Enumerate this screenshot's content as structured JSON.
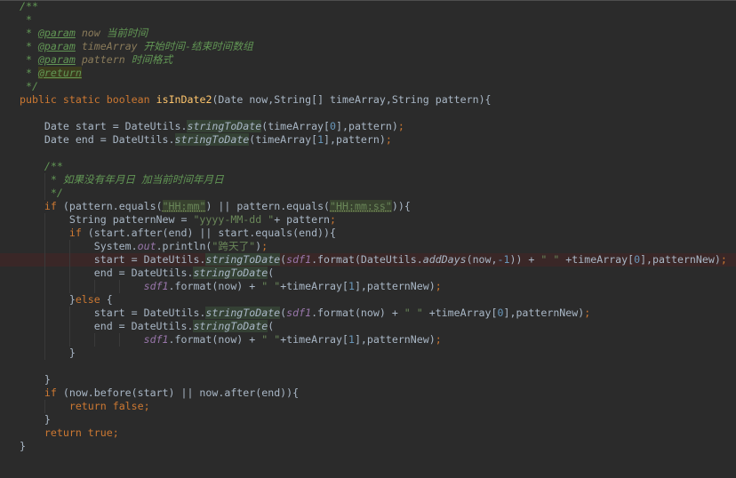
{
  "theme": {
    "background": "#2B2B2B",
    "text": "#A9B7C6",
    "keyword": "#CC7832",
    "doc_comment": "#629755",
    "doc_param": "#8A7B5A",
    "method": "#FFC66D",
    "static_field": "#9876AA",
    "string": "#6A8759",
    "number": "#6897BB",
    "usage_highlight": "#344134",
    "marked_line": "#3A2727",
    "tag_highlight": "#3C3C1E"
  },
  "lines": [
    {
      "tokens": [
        {
          "t": "/**",
          "k": "doc"
        }
      ]
    },
    {
      "tokens": [
        {
          "t": " *",
          "k": "doc"
        }
      ]
    },
    {
      "tokens": [
        {
          "t": " * ",
          "k": "doc"
        },
        {
          "t": "@param",
          "k": "tag"
        },
        {
          "t": " ",
          "k": "doc"
        },
        {
          "t": "now",
          "k": "docval"
        },
        {
          "t": " 当前时间",
          "k": "doc"
        }
      ]
    },
    {
      "tokens": [
        {
          "t": " * ",
          "k": "doc"
        },
        {
          "t": "@param",
          "k": "tag"
        },
        {
          "t": " ",
          "k": "doc"
        },
        {
          "t": "timeArray",
          "k": "docval"
        },
        {
          "t": " 开始时间-结束时间数组",
          "k": "doc"
        }
      ]
    },
    {
      "tokens": [
        {
          "t": " * ",
          "k": "doc"
        },
        {
          "t": "@param",
          "k": "tag"
        },
        {
          "t": " ",
          "k": "doc"
        },
        {
          "t": "pattern",
          "k": "docval"
        },
        {
          "t": " 时间格式",
          "k": "doc"
        }
      ]
    },
    {
      "tokens": [
        {
          "t": " * ",
          "k": "doc"
        },
        {
          "t": "@return",
          "k": "tag",
          "hl": "tag"
        }
      ]
    },
    {
      "tokens": [
        {
          "t": " */",
          "k": "doc"
        }
      ]
    },
    {
      "tokens": [
        {
          "t": "public",
          "k": "kw"
        },
        {
          "t": " ",
          "k": "p"
        },
        {
          "t": "static",
          "k": "kw"
        },
        {
          "t": " ",
          "k": "p"
        },
        {
          "t": "boolean",
          "k": "kw"
        },
        {
          "t": " ",
          "k": "p"
        },
        {
          "t": "isInDate2",
          "k": "meth"
        },
        {
          "t": "(Date now,String[] timeArray,String pattern){",
          "k": "p"
        }
      ]
    },
    {
      "tokens": []
    },
    {
      "tokens": [
        {
          "t": "    Date start = DateUtils.",
          "k": "p"
        },
        {
          "t": "stringToDate",
          "k": "scall",
          "hl": "usage"
        },
        {
          "t": "(timeArray[",
          "k": "p"
        },
        {
          "t": "0",
          "k": "num"
        },
        {
          "t": "],pattern)",
          "k": "p"
        },
        {
          "t": ";",
          "k": "kw"
        }
      ]
    },
    {
      "tokens": [
        {
          "t": "    Date end = DateUtils.",
          "k": "p"
        },
        {
          "t": "stringToDate",
          "k": "scall",
          "hl": "usage"
        },
        {
          "t": "(timeArray[",
          "k": "p"
        },
        {
          "t": "1",
          "k": "num"
        },
        {
          "t": "],pattern)",
          "k": "p"
        },
        {
          "t": ";",
          "k": "kw"
        }
      ]
    },
    {
      "tokens": []
    },
    {
      "tokens": [
        {
          "t": "    /**",
          "k": "doc"
        }
      ]
    },
    {
      "tokens": [
        {
          "t": "     * 如果没有年月日 加当前时间年月日",
          "k": "doc"
        }
      ]
    },
    {
      "tokens": [
        {
          "t": "     */",
          "k": "doc"
        }
      ]
    },
    {
      "tokens": [
        {
          "t": "    ",
          "k": "p"
        },
        {
          "t": "if",
          "k": "kw"
        },
        {
          "t": " (pattern.equals(",
          "k": "p"
        },
        {
          "t": "\"HH:mm\"",
          "k": "str",
          "hl": "inject"
        },
        {
          "t": ") || pattern.equals(",
          "k": "p"
        },
        {
          "t": "\"HH:mm:ss\"",
          "k": "str",
          "hl": "inject"
        },
        {
          "t": ")){",
          "k": "p"
        }
      ]
    },
    {
      "tokens": [
        {
          "t": "        String patternNew = ",
          "k": "p"
        },
        {
          "t": "\"yyyy-MM-dd \"",
          "k": "str"
        },
        {
          "t": "+ pattern",
          "k": "p"
        },
        {
          "t": ";",
          "k": "kw"
        }
      ]
    },
    {
      "tokens": [
        {
          "t": "        ",
          "k": "p"
        },
        {
          "t": "if",
          "k": "kw"
        },
        {
          "t": " (start.after(end) || start.equals(end)){",
          "k": "p"
        }
      ]
    },
    {
      "tokens": [
        {
          "t": "            System.",
          "k": "p"
        },
        {
          "t": "out",
          "k": "field"
        },
        {
          "t": ".println(",
          "k": "p"
        },
        {
          "t": "\"跨天了\"",
          "k": "str"
        },
        {
          "t": ")",
          "k": "p"
        },
        {
          "t": ";",
          "k": "kw"
        }
      ]
    },
    {
      "marked": true,
      "tokens": [
        {
          "t": "            start = DateUtils.",
          "k": "p"
        },
        {
          "t": "stringToDate",
          "k": "scall",
          "hl": "usage"
        },
        {
          "t": "(",
          "k": "p"
        },
        {
          "t": "sdf1",
          "k": "field"
        },
        {
          "t": ".format(DateUtils.",
          "k": "p"
        },
        {
          "t": "addDays",
          "k": "scall"
        },
        {
          "t": "(now,",
          "k": "p"
        },
        {
          "t": "-1",
          "k": "num"
        },
        {
          "t": ")) + ",
          "k": "p"
        },
        {
          "t": "\" \"",
          "k": "str"
        },
        {
          "t": " +timeArray[",
          "k": "p"
        },
        {
          "t": "0",
          "k": "num"
        },
        {
          "t": "],patternNew)",
          "k": "p"
        },
        {
          "t": ";",
          "k": "kw"
        }
      ]
    },
    {
      "tokens": [
        {
          "t": "            end = DateUtils.",
          "k": "p"
        },
        {
          "t": "stringToDate",
          "k": "scall",
          "hl": "usage"
        },
        {
          "t": "(",
          "k": "p"
        }
      ]
    },
    {
      "tokens": [
        {
          "t": "                    ",
          "k": "p"
        },
        {
          "t": "sdf1",
          "k": "field"
        },
        {
          "t": ".format(now) + ",
          "k": "p"
        },
        {
          "t": "\" \"",
          "k": "str"
        },
        {
          "t": "+timeArray[",
          "k": "p"
        },
        {
          "t": "1",
          "k": "num"
        },
        {
          "t": "],patternNew)",
          "k": "p"
        },
        {
          "t": ";",
          "k": "kw"
        }
      ]
    },
    {
      "tokens": [
        {
          "t": "        }",
          "k": "p"
        },
        {
          "t": "else",
          "k": "kw"
        },
        {
          "t": " {",
          "k": "p"
        }
      ]
    },
    {
      "tokens": [
        {
          "t": "            start = DateUtils.",
          "k": "p"
        },
        {
          "t": "stringToDate",
          "k": "scall",
          "hl": "usage"
        },
        {
          "t": "(",
          "k": "p"
        },
        {
          "t": "sdf1",
          "k": "field"
        },
        {
          "t": ".format(now) + ",
          "k": "p"
        },
        {
          "t": "\" \"",
          "k": "str"
        },
        {
          "t": " +timeArray[",
          "k": "p"
        },
        {
          "t": "0",
          "k": "num"
        },
        {
          "t": "],patternNew)",
          "k": "p"
        },
        {
          "t": ";",
          "k": "kw"
        }
      ]
    },
    {
      "tokens": [
        {
          "t": "            end = DateUtils.",
          "k": "p"
        },
        {
          "t": "stringToDate",
          "k": "scall",
          "hl": "usage"
        },
        {
          "t": "(",
          "k": "p"
        }
      ]
    },
    {
      "tokens": [
        {
          "t": "                    ",
          "k": "p"
        },
        {
          "t": "sdf1",
          "k": "field"
        },
        {
          "t": ".format(now) + ",
          "k": "p"
        },
        {
          "t": "\" \"",
          "k": "str"
        },
        {
          "t": "+timeArray[",
          "k": "p"
        },
        {
          "t": "1",
          "k": "num"
        },
        {
          "t": "],patternNew)",
          "k": "p"
        },
        {
          "t": ";",
          "k": "kw"
        }
      ]
    },
    {
      "tokens": [
        {
          "t": "        }",
          "k": "p"
        }
      ]
    },
    {
      "tokens": []
    },
    {
      "tokens": [
        {
          "t": "    }",
          "k": "p"
        }
      ]
    },
    {
      "tokens": [
        {
          "t": "    ",
          "k": "p"
        },
        {
          "t": "if",
          "k": "kw"
        },
        {
          "t": " (now.before(start) || now.after(end)){",
          "k": "p"
        }
      ]
    },
    {
      "tokens": [
        {
          "t": "        ",
          "k": "p"
        },
        {
          "t": "return",
          "k": "kw"
        },
        {
          "t": " ",
          "k": "p"
        },
        {
          "t": "false",
          "k": "kw"
        },
        {
          "t": ";",
          "k": "kw"
        }
      ]
    },
    {
      "tokens": [
        {
          "t": "    }",
          "k": "p"
        }
      ]
    },
    {
      "tokens": [
        {
          "t": "    ",
          "k": "p"
        },
        {
          "t": "return",
          "k": "kw"
        },
        {
          "t": " ",
          "k": "p"
        },
        {
          "t": "true",
          "k": "kw"
        },
        {
          "t": ";",
          "k": "kw"
        }
      ]
    },
    {
      "tokens": [
        {
          "t": "}",
          "k": "p"
        }
      ]
    }
  ]
}
